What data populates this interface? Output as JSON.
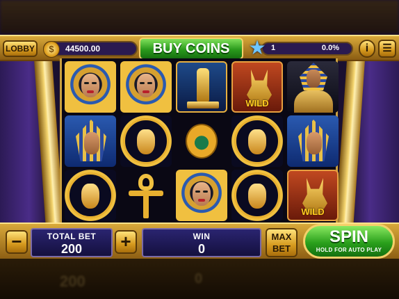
{
  "header": {
    "lobby_label": "LOBBY",
    "coin_icon": "coin-icon",
    "coin_symbol": "$",
    "coins": "44500.00",
    "buy_coins_label": "BUY COINS",
    "level_icon": "star-icon",
    "level": "1",
    "level_progress_text": "0.0%",
    "level_progress": 0.0,
    "info_label": "i",
    "menu_label": "☰"
  },
  "reels": [
    [
      "cleopatra",
      "pharaoh-portrait",
      "pharaoh-mask"
    ],
    [
      "cleopatra",
      "pharaoh-mask",
      "ankh"
    ],
    [
      "horus-statue",
      "scarab",
      "cleopatra"
    ],
    [
      "anubis-wild",
      "pharaoh-mask",
      "pharaoh-mask"
    ],
    [
      "pharaoh-king",
      "pharaoh-portrait",
      "anubis-wild"
    ]
  ],
  "wild_label": "WILD",
  "controls": {
    "minus_label": "−",
    "plus_label": "+",
    "total_bet_label": "TOTAL BET",
    "total_bet": "200",
    "win_label": "WIN",
    "win": "0",
    "max_bet_label": "MAX BET",
    "spin_label": "SPIN",
    "spin_hint": "HOLD FOR AUTO PLAY"
  },
  "colors": {
    "gold": "#d9a93a",
    "green": "#2aa01c",
    "panel": "#2a2470"
  }
}
